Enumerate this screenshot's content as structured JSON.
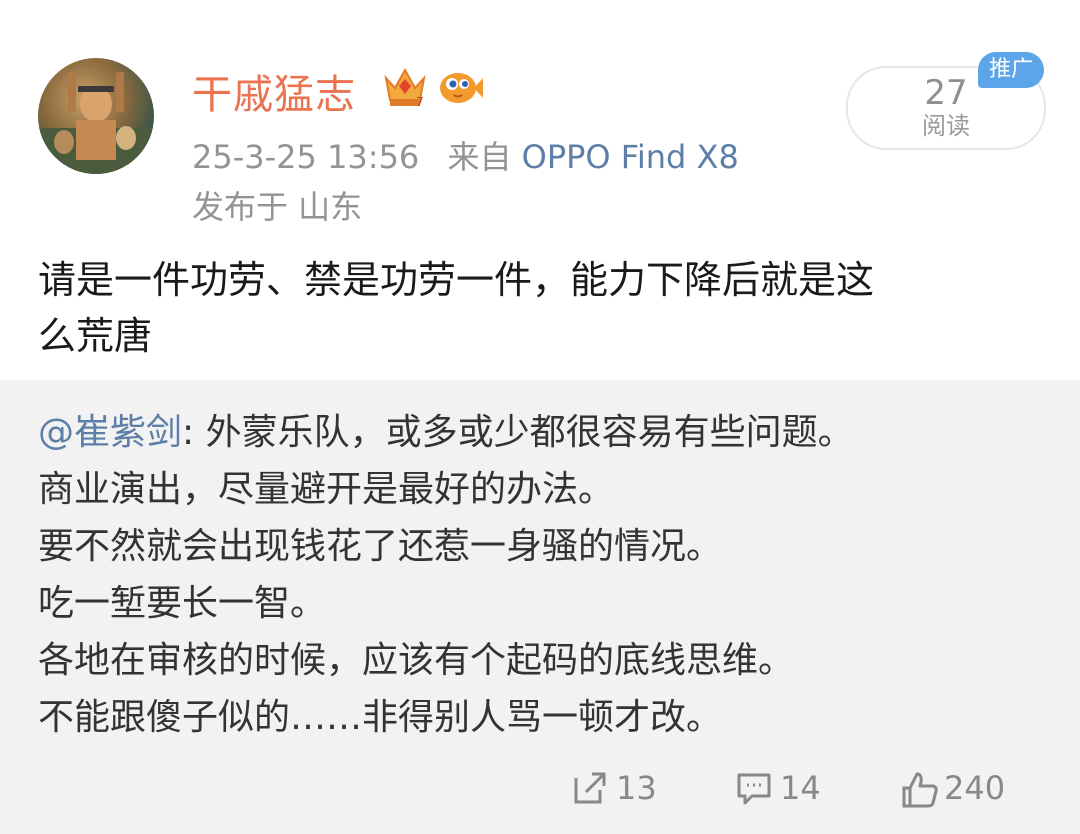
{
  "post": {
    "username": "干戚猛志",
    "timestamp": "25-3-25 13:56",
    "source_prefix": "来自",
    "device": "OPPO Find X8",
    "location": "发布于 山东",
    "read_count": "27",
    "read_label": "阅读",
    "ad_badge": "推广",
    "text_line1": "请是一件功劳、禁是功劳一件，能力下降后就是这",
    "text_line2": "么荒唐"
  },
  "quote": {
    "mention": "@崔紫剑",
    "lines": [
      ": 外蒙乐队，或多或少都很容易有些问题。",
      "商业演出，尽量避开是最好的办法。",
      "要不然就会出现钱花了还惹一身骚的情况。",
      "吃一堑要长一智。",
      "各地在审核的时候，应该有个起码的底线思维。",
      "不能跟傻子似的……非得别人骂一顿才改。"
    ]
  },
  "actions": {
    "repost_count": "13",
    "comment_count": "14",
    "like_count": "240"
  },
  "icons": {
    "crown": "crown-badge-icon",
    "fish": "fish-badge-icon",
    "repost": "repost-icon",
    "comment": "comment-icon",
    "like": "thumbs-up-icon"
  },
  "colors": {
    "username": "#eb7350",
    "link": "#5d7fa7",
    "ad_badge": "#5ba5e8",
    "meta_text": "#939393"
  }
}
